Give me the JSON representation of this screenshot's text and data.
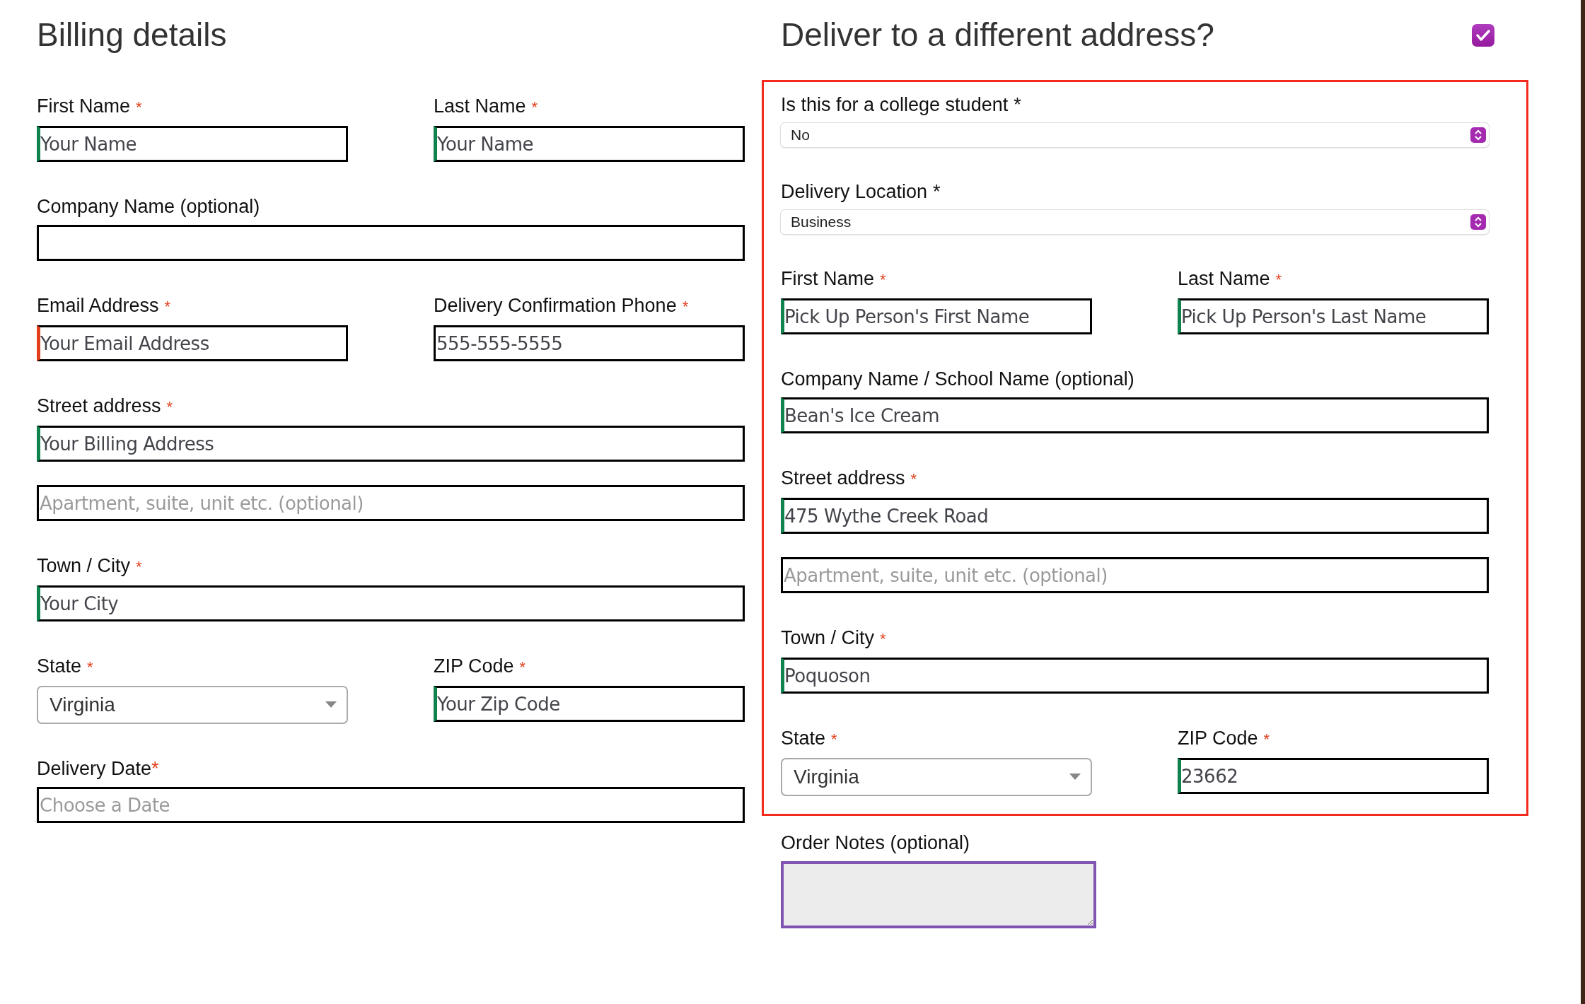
{
  "billing": {
    "title": "Billing details",
    "rows": [
      [
        {
          "kind": "text",
          "label": "First Name",
          "required": {
            "mark": "*",
            "kind": "red"
          },
          "value": "Your Name",
          "valid": true
        },
        {
          "kind": "text",
          "label": "Last Name",
          "required": {
            "mark": "*",
            "kind": "red"
          },
          "value": "Your Name",
          "valid": true
        }
      ],
      [
        {
          "kind": "text",
          "label": "Company Name (optional)"
        }
      ],
      [
        {
          "kind": "text",
          "label": "Email Address",
          "required": {
            "mark": "*",
            "kind": "red"
          },
          "value": "Your Email Address",
          "valid": false
        },
        {
          "kind": "text",
          "label": "Delivery Confirmation Phone",
          "required": {
            "mark": "*",
            "kind": "red"
          },
          "value": "555-555-5555"
        }
      ],
      [
        {
          "kind": "text",
          "label": "Street address",
          "required": {
            "mark": "*",
            "kind": "red"
          },
          "value": "Your Billing Address",
          "valid": true
        }
      ],
      [
        {
          "kind": "text",
          "placeholder": "Apartment, suite, unit etc. (optional)"
        }
      ],
      [
        {
          "kind": "text",
          "label": "Town / City",
          "required": {
            "mark": "*",
            "kind": "red"
          },
          "value": "Your City",
          "valid": true
        }
      ],
      [
        {
          "kind": "select",
          "label": "State",
          "required": {
            "mark": "*",
            "kind": "red"
          },
          "value": "Virginia"
        },
        {
          "kind": "text",
          "label": "ZIP Code",
          "required": {
            "mark": "*",
            "kind": "red"
          },
          "value": "Your Zip Code",
          "valid": true
        }
      ],
      [
        {
          "kind": "text",
          "label": "Delivery Date",
          "required": {
            "mark": "*",
            "kind": "tight"
          },
          "placeholder": "Choose a Date"
        }
      ]
    ]
  },
  "shipping": {
    "title": "Deliver to a different address?",
    "enabled": true,
    "rows": [
      [
        {
          "kind": "native-select",
          "label": "Is this for a college student",
          "required": {
            "mark": "*",
            "kind": "plain"
          },
          "value": "No"
        }
      ],
      [
        {
          "kind": "native-select",
          "label": "Delivery Location",
          "required": {
            "mark": "*",
            "kind": "plain"
          },
          "value": "Business"
        }
      ],
      [
        {
          "kind": "text",
          "label": "First Name",
          "required": {
            "mark": "*",
            "kind": "red"
          },
          "value": "Pick Up Person's First Name",
          "valid": true
        },
        {
          "kind": "text",
          "label": "Last Name",
          "required": {
            "mark": "*",
            "kind": "red"
          },
          "value": "Pick Up Person's Last Name",
          "valid": true
        }
      ],
      [
        {
          "kind": "text",
          "label": "Company Name / School Name (optional)",
          "value": "Bean's Ice Cream",
          "valid": true
        }
      ],
      [
        {
          "kind": "text",
          "label": "Street address",
          "required": {
            "mark": "*",
            "kind": "red"
          },
          "value": "475 Wythe Creek Road",
          "valid": true
        }
      ],
      [
        {
          "kind": "text",
          "placeholder": "Apartment, suite, unit etc. (optional)"
        }
      ],
      [
        {
          "kind": "text",
          "label": "Town / City",
          "required": {
            "mark": "*",
            "kind": "red"
          },
          "value": "Poquoson",
          "valid": true
        }
      ],
      [
        {
          "kind": "select",
          "label": "State",
          "required": {
            "mark": "*",
            "kind": "red"
          },
          "value": "Virginia"
        },
        {
          "kind": "text",
          "label": "ZIP Code",
          "required": {
            "mark": "*",
            "kind": "red"
          },
          "value": "23662",
          "valid": true
        }
      ]
    ],
    "notes": {
      "kind": "textarea",
      "label": "Order Notes (optional)",
      "focused": true
    }
  }
}
